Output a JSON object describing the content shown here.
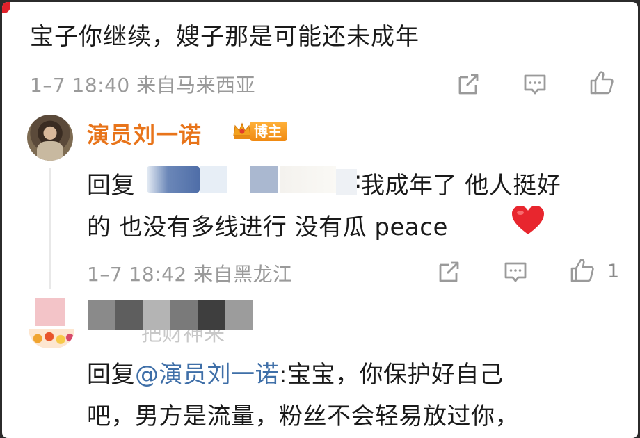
{
  "top_comment": {
    "text": "宝子你继续，嫂子那是可能还未成年",
    "meta": "1–7 18:40 来自马来西亚"
  },
  "reply1": {
    "username": "演员刘一诺",
    "badge": "博主",
    "prefix": "回复",
    "sep": ":",
    "line1_rest": "我成年了 他人挺好",
    "line2": "的 也没有多线进行 没有瓜 peace",
    "meta": "1–7 18:42 来自黑龙江",
    "like_count": "1"
  },
  "reply2": {
    "faded_username": "把财神来",
    "prefix": "回复",
    "mention": "@演员刘一诺",
    "line1_rest": ":宝宝，你保护好自己",
    "line2": "吧，男方是流量，粉丝不会轻易放过你，"
  },
  "icons": {
    "share": "share-icon",
    "comment": "comment-icon",
    "like": "like-icon",
    "heart": "red-heart-emoji",
    "crown": "crown-icon"
  },
  "colors": {
    "username": "#e8741a",
    "mention": "#3f6fa8",
    "meta": "#9a9a9a",
    "heart": "#e8262e"
  }
}
